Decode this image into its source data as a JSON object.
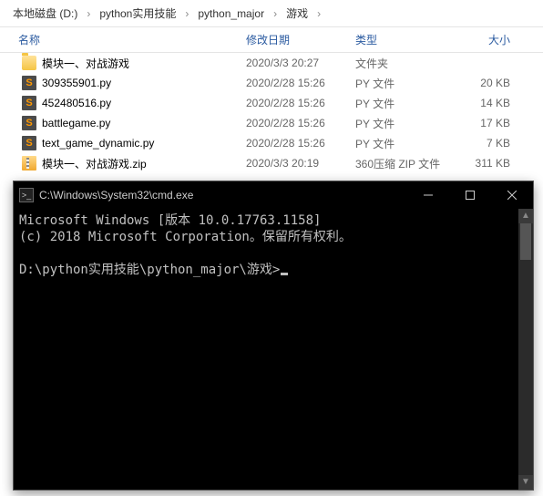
{
  "breadcrumb": [
    "本地磁盘 (D:)",
    "python实用技能",
    "python_major",
    "游戏"
  ],
  "columns": {
    "name": "名称",
    "date": "修改日期",
    "type": "类型",
    "size": "大小"
  },
  "files": [
    {
      "icon": "folder",
      "name": "模块一、对战游戏",
      "date": "2020/3/3 20:27",
      "type": "文件夹",
      "size": ""
    },
    {
      "icon": "py",
      "name": "309355901.py",
      "date": "2020/2/28 15:26",
      "type": "PY 文件",
      "size": "20 KB"
    },
    {
      "icon": "py",
      "name": "452480516.py",
      "date": "2020/2/28 15:26",
      "type": "PY 文件",
      "size": "14 KB"
    },
    {
      "icon": "py",
      "name": "battlegame.py",
      "date": "2020/2/28 15:26",
      "type": "PY 文件",
      "size": "17 KB"
    },
    {
      "icon": "py",
      "name": "text_game_dynamic.py",
      "date": "2020/2/28 15:26",
      "type": "PY 文件",
      "size": "7 KB"
    },
    {
      "icon": "zip",
      "name": "模块一、对战游戏.zip",
      "date": "2020/3/3 20:19",
      "type": "360压缩 ZIP 文件",
      "size": "311 KB"
    }
  ],
  "cmd": {
    "title": "C:\\Windows\\System32\\cmd.exe",
    "line1": "Microsoft Windows [版本 10.0.17763.1158]",
    "line2": "(c) 2018 Microsoft Corporation。保留所有权利。",
    "prompt": "D:\\python实用技能\\python_major\\游戏>"
  }
}
